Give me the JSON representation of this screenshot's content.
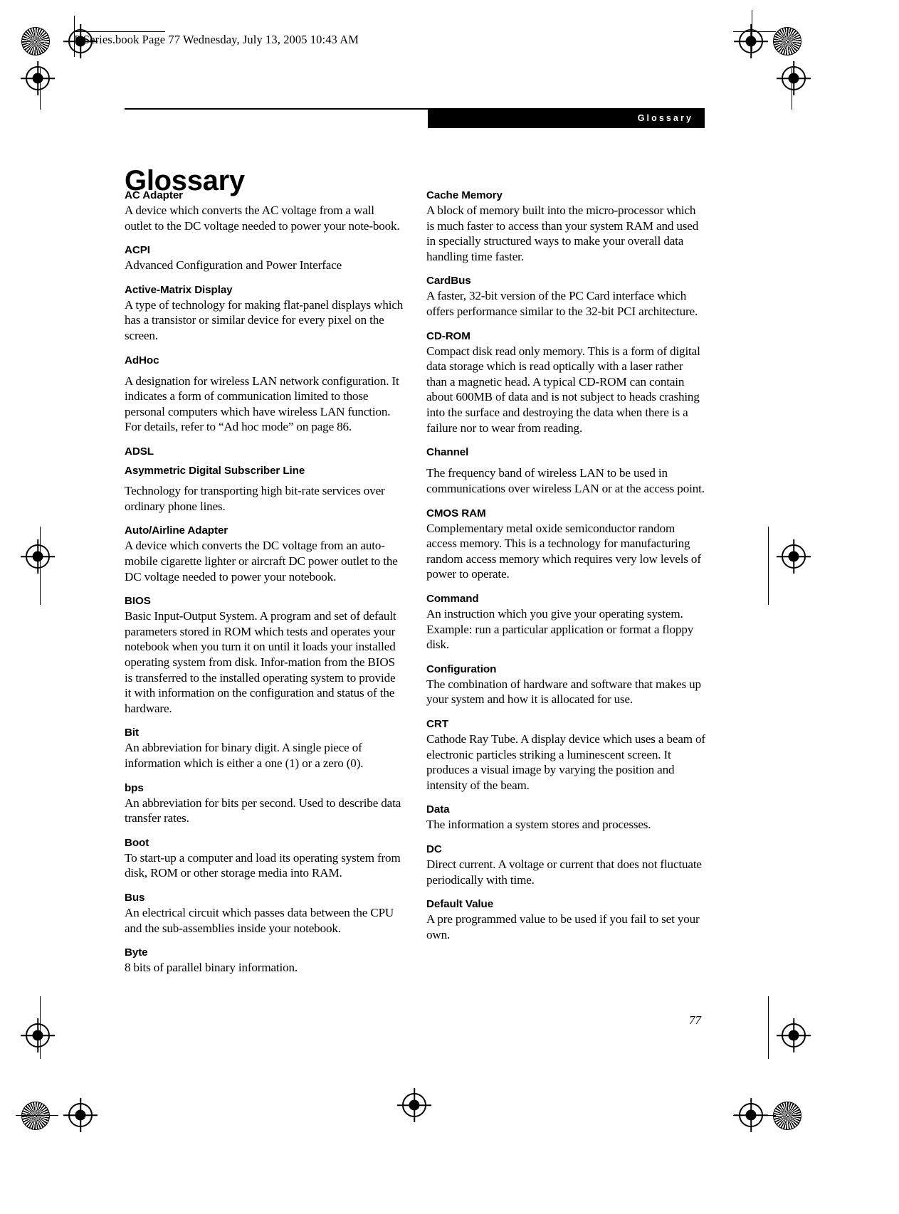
{
  "header": {
    "slug": "P Series.book  Page 77  Wednesday, July 13, 2005  10:43 AM"
  },
  "running_head": {
    "label": "Glossary"
  },
  "chapter": {
    "title": "Glossary"
  },
  "folio": {
    "page_number": "77"
  },
  "colors": {
    "running_head_bg": "#000000",
    "running_head_text": "#ffffff",
    "body_text": "#000000",
    "page_bg": "#ffffff"
  },
  "columns": {
    "left": [
      {
        "term": "AC Adapter",
        "definition": "A device which converts the AC voltage from a wall outlet to the DC voltage needed to power your note-book."
      },
      {
        "term": "ACPI",
        "definition": "Advanced Configuration and Power Interface"
      },
      {
        "term": "Active-Matrix Display",
        "definition": "A type of technology for making flat-panel displays which has a transistor or similar device for every pixel on the screen."
      },
      {
        "term": "AdHoc",
        "definition": "A designation for wireless LAN network configuration. It indicates a form of communication limited to those personal computers which have wireless LAN function. For details, refer to “Ad hoc mode” on page 86.",
        "spaced": true
      },
      {
        "term": "ADSL",
        "subterm": "Asymmetric Digital Subscriber Line",
        "definition": "Technology for transporting high bit-rate services over ordinary phone lines.",
        "spaced": true
      },
      {
        "term": "Auto/Airline Adapter",
        "definition": "A device which converts the DC voltage from an auto-mobile cigarette lighter or aircraft DC power outlet to the DC voltage needed to power your notebook."
      },
      {
        "term": "BIOS",
        "definition": "Basic Input-Output System. A program and set of default parameters stored in ROM which tests and operates your notebook when you turn it on until it loads your installed operating system from disk. Infor-mation from the BIOS is transferred to the installed operating system to provide it with information on the configuration and status of the hardware."
      },
      {
        "term": "Bit",
        "definition": "An abbreviation for binary digit. A single piece of information which is either a one (1) or a zero (0)."
      },
      {
        "term": "bps",
        "definition": "An abbreviation for bits per second. Used to describe data transfer rates."
      },
      {
        "term": "Boot",
        "definition": "To start-up a computer and load its operating system from disk, ROM or other storage media into RAM."
      },
      {
        "term": "Bus",
        "definition": "An electrical circuit which passes data between the CPU and the sub-assemblies inside your notebook."
      },
      {
        "term": "Byte",
        "definition": "8 bits of parallel binary information."
      }
    ],
    "right": [
      {
        "term": "Cache Memory",
        "definition": "A block of memory built into the micro-processor which is much faster to access than your system RAM and used in specially structured ways to make your overall data handling time faster."
      },
      {
        "term": "CardBus",
        "definition": "A faster, 32-bit version of the PC Card interface which offers performance similar to the 32-bit PCI architecture."
      },
      {
        "term": "CD-ROM",
        "definition": "Compact disk read only memory. This is a form of digital data storage which is read optically with a laser rather than a magnetic head. A typical CD-ROM can contain about 600MB of data and is not subject to heads crashing into the surface and destroying the data when there is a failure nor to wear from reading."
      },
      {
        "term": "Channel",
        "definition": "The frequency band of wireless LAN to be used in communications over wireless LAN or at the access point.",
        "spaced": true
      },
      {
        "term": "CMOS RAM",
        "definition": "Complementary metal oxide semiconductor random access memory. This is a technology for manufacturing random access memory which requires very low levels of power to operate."
      },
      {
        "term": "Command",
        "definition": "An instruction which you give your operating system. Example: run a particular application or format a floppy disk."
      },
      {
        "term": "Configuration",
        "definition": "The combination of hardware and software that makes up your system and how it is allocated for use."
      },
      {
        "term": "CRT",
        "definition": "Cathode Ray Tube. A display device which uses a beam of electronic particles striking a luminescent screen. It produces a visual image by varying the position and intensity of the beam."
      },
      {
        "term": "Data",
        "definition": "The information a system stores and processes."
      },
      {
        "term": "DC",
        "definition": "Direct current. A voltage or current that does not fluctuate periodically with time."
      },
      {
        "term": "Default Value",
        "definition": "A pre programmed value to be used if you fail to set your own."
      }
    ]
  }
}
